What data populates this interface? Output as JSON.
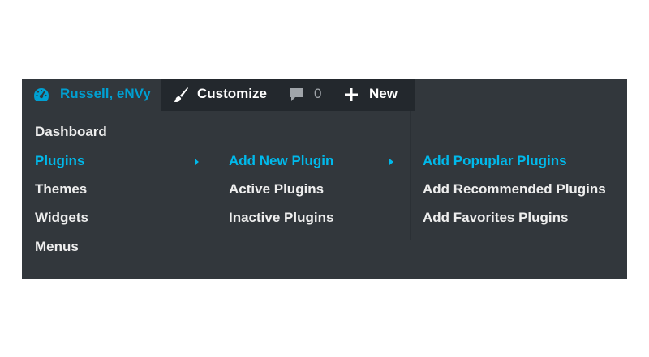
{
  "adminbar": {
    "site": {
      "label": "Russell, eNVy",
      "icon": "dashboard-gauge-icon"
    },
    "customize": {
      "label": "Customize",
      "icon": "paintbrush-icon"
    },
    "comments": {
      "count": "0",
      "icon": "comment-bubble-icon"
    },
    "new": {
      "label": "New",
      "icon": "plus-icon"
    }
  },
  "menu": {
    "main": [
      "Dashboard",
      "Plugins",
      "Themes",
      "Widgets",
      "Menus"
    ],
    "plugins_submenu": [
      "Add New Plugin",
      "Active Plugins",
      "Inactive Plugins"
    ],
    "add_new_submenu": [
      "Add Popuplar Plugins",
      "Add Recommended Plugins",
      "Add Favorites Plugins"
    ]
  },
  "colors": {
    "bar_bg": "#32373c",
    "bar_dark": "#23282d",
    "accent": "#00b9eb",
    "text": "#eeeeee"
  }
}
